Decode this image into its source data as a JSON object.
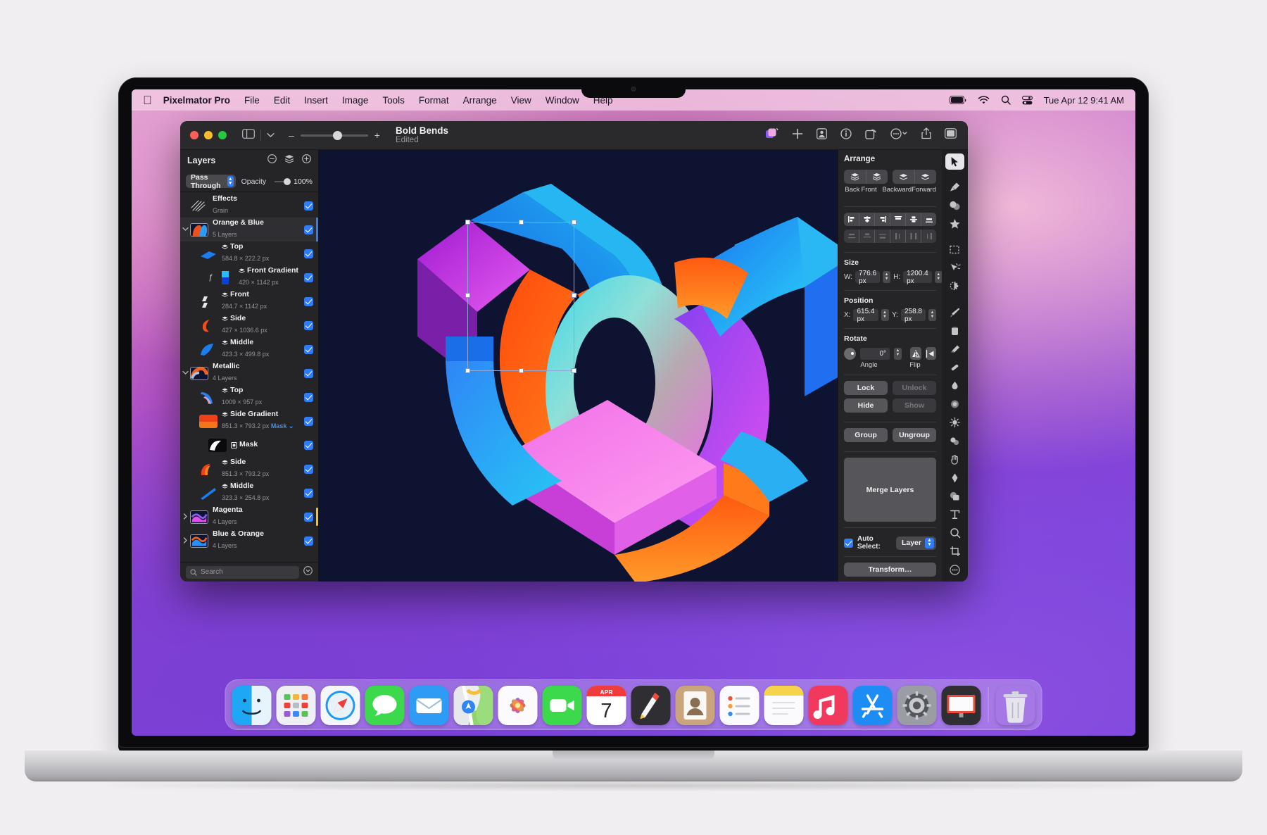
{
  "menubar": {
    "apple": "",
    "app": "Pixelmator Pro",
    "items": [
      "File",
      "Edit",
      "Insert",
      "Image",
      "Tools",
      "Format",
      "Arrange",
      "View",
      "Window",
      "Help"
    ],
    "status_icons": [
      "battery-icon",
      "wifi-icon",
      "search-icon",
      "control-center-icon"
    ],
    "clock": "Tue Apr 12  9:41 AM"
  },
  "window": {
    "title": "Bold Bends",
    "subtitle": "Edited",
    "zoom_minus": "–",
    "zoom_plus": "+",
    "toolbar_icons": [
      "ml-layers-icon",
      "add-icon",
      "photo-icon",
      "info-icon",
      "rotate-icon",
      "more-icon",
      "share-icon",
      "panel-toggle-icon"
    ]
  },
  "layers_panel": {
    "title": "Layers",
    "header_icons": [
      "minus-circle-icon",
      "layers-stack-icon",
      "plus-circle-icon"
    ],
    "blend_mode": "Pass Through",
    "opacity_label": "Opacity",
    "opacity_value": "100%",
    "search_placeholder": "Search",
    "items": [
      {
        "name": "Effects",
        "sub": "Grain",
        "indent": 0,
        "kind": "effect",
        "thumb": "effects",
        "disclosure": "",
        "visible": true,
        "selected": false
      },
      {
        "name": "Orange & Blue",
        "sub": "5 Layers",
        "indent": 0,
        "kind": "group",
        "thumb": "orangeblue",
        "disclosure": "down",
        "visible": true,
        "selected": true
      },
      {
        "name": "Top",
        "sub": "584.8 × 222.2 px",
        "indent": 1,
        "kind": "layer",
        "thumb": "blue-sliver",
        "disclosure": "",
        "visible": true,
        "selected": false
      },
      {
        "name": "Front Gradient",
        "sub": "420 × 1142 px",
        "indent": 2,
        "kind": "layer",
        "thumb": "blue-grad",
        "disclosure": "",
        "visible": true,
        "selected": false,
        "fx": true
      },
      {
        "name": "Front",
        "sub": "284.7 × 1142 px",
        "indent": 1,
        "kind": "layer",
        "thumb": "gray-strip",
        "disclosure": "",
        "visible": true,
        "selected": false
      },
      {
        "name": "Side",
        "sub": "427 × 1036.6 px",
        "indent": 1,
        "kind": "layer",
        "thumb": "orange-hook",
        "disclosure": "",
        "visible": true,
        "selected": false
      },
      {
        "name": "Middle",
        "sub": "423.3 × 499.8 px",
        "indent": 1,
        "kind": "layer",
        "thumb": "blue-curve",
        "disclosure": "",
        "visible": true,
        "selected": false
      },
      {
        "name": "Metallic",
        "sub": "4 Layers",
        "indent": 0,
        "kind": "group",
        "thumb": "metallic",
        "disclosure": "down",
        "visible": true,
        "selected": false
      },
      {
        "name": "Top",
        "sub": "1009 × 957 px",
        "indent": 1,
        "kind": "layer",
        "thumb": "metal-arc",
        "disclosure": "",
        "visible": true,
        "selected": false
      },
      {
        "name": "Side Gradient",
        "sub": "851.3 × 793.2 px",
        "mask_link": "Mask",
        "indent": 1,
        "kind": "layer",
        "thumb": "orange-sq",
        "disclosure": "",
        "visible": true,
        "selected": false
      },
      {
        "name": "Mask",
        "sub": "",
        "indent": 2,
        "kind": "mask",
        "thumb": "mask-bw",
        "disclosure": "",
        "visible": true,
        "selected": false
      },
      {
        "name": "Side",
        "sub": "851.3 × 793.2 px",
        "indent": 1,
        "kind": "layer",
        "thumb": "orange-hook2",
        "disclosure": "",
        "visible": true,
        "selected": false
      },
      {
        "name": "Middle",
        "sub": "323.3 × 254.8 px",
        "indent": 1,
        "kind": "layer",
        "thumb": "blue-slash",
        "disclosure": "",
        "visible": true,
        "selected": false
      },
      {
        "name": "Magenta",
        "sub": "4 Layers",
        "indent": 0,
        "kind": "group",
        "thumb": "magenta",
        "disclosure": "right",
        "visible": true,
        "selected": false,
        "marker": "yellow"
      },
      {
        "name": "Blue & Orange",
        "sub": "4 Layers",
        "indent": 0,
        "kind": "group",
        "thumb": "blueorange",
        "disclosure": "right",
        "visible": true,
        "selected": false
      }
    ]
  },
  "arrange_panel": {
    "title": "Arrange",
    "order_buttons": [
      "Back",
      "Front",
      "Backward",
      "Forward"
    ],
    "size": {
      "label": "Size",
      "w_label": "W:",
      "w_value": "776.6 px",
      "h_label": "H:",
      "h_value": "1200.4 px"
    },
    "position": {
      "label": "Position",
      "x_label": "X:",
      "x_value": "615.4 px",
      "y_label": "Y:",
      "y_value": "258.8 px"
    },
    "rotate": {
      "label": "Rotate",
      "angle_value": "0°",
      "angle_label": "Angle",
      "flip_label": "Flip"
    },
    "buttons": {
      "lock": "Lock",
      "unlock": "Unlock",
      "hide": "Hide",
      "show": "Show",
      "group": "Group",
      "ungroup": "Ungroup",
      "merge": "Merge Layers",
      "transform": "Transform…"
    },
    "auto_select": {
      "label": "Auto Select:",
      "value": "Layer",
      "checked": true
    }
  },
  "tools": [
    "arrow-tool",
    "crop-tool",
    "color-adjust-tool",
    "effects-tool",
    "marquee-select-tool",
    "quick-select-tool",
    "magic-wand-tool",
    "paint-brush-tool",
    "paint-bucket-tool",
    "eraser-tool",
    "repair-tool",
    "smudge-tool",
    "blur-tool",
    "lighten-tool",
    "clone-stamp-tool",
    "hand-tool",
    "pen-tool",
    "shape-tool",
    "type-tool",
    "zoom-tool",
    "crop-frame-tool",
    "more-tools"
  ],
  "dock": {
    "apps": [
      "Finder",
      "Launchpad",
      "Safari",
      "Messages",
      "Mail",
      "Maps",
      "Photos",
      "FaceTime",
      "Calendar",
      "Pixelmator Pro",
      "Contacts",
      "Reminders",
      "Notes",
      "Music",
      "App Store",
      "System Settings",
      "Keynote"
    ],
    "calendar_month": "APR",
    "calendar_day": "7",
    "trash": "Trash"
  },
  "canvas": {
    "background_color": "#0d1330",
    "selection": {
      "handles": 8
    }
  }
}
